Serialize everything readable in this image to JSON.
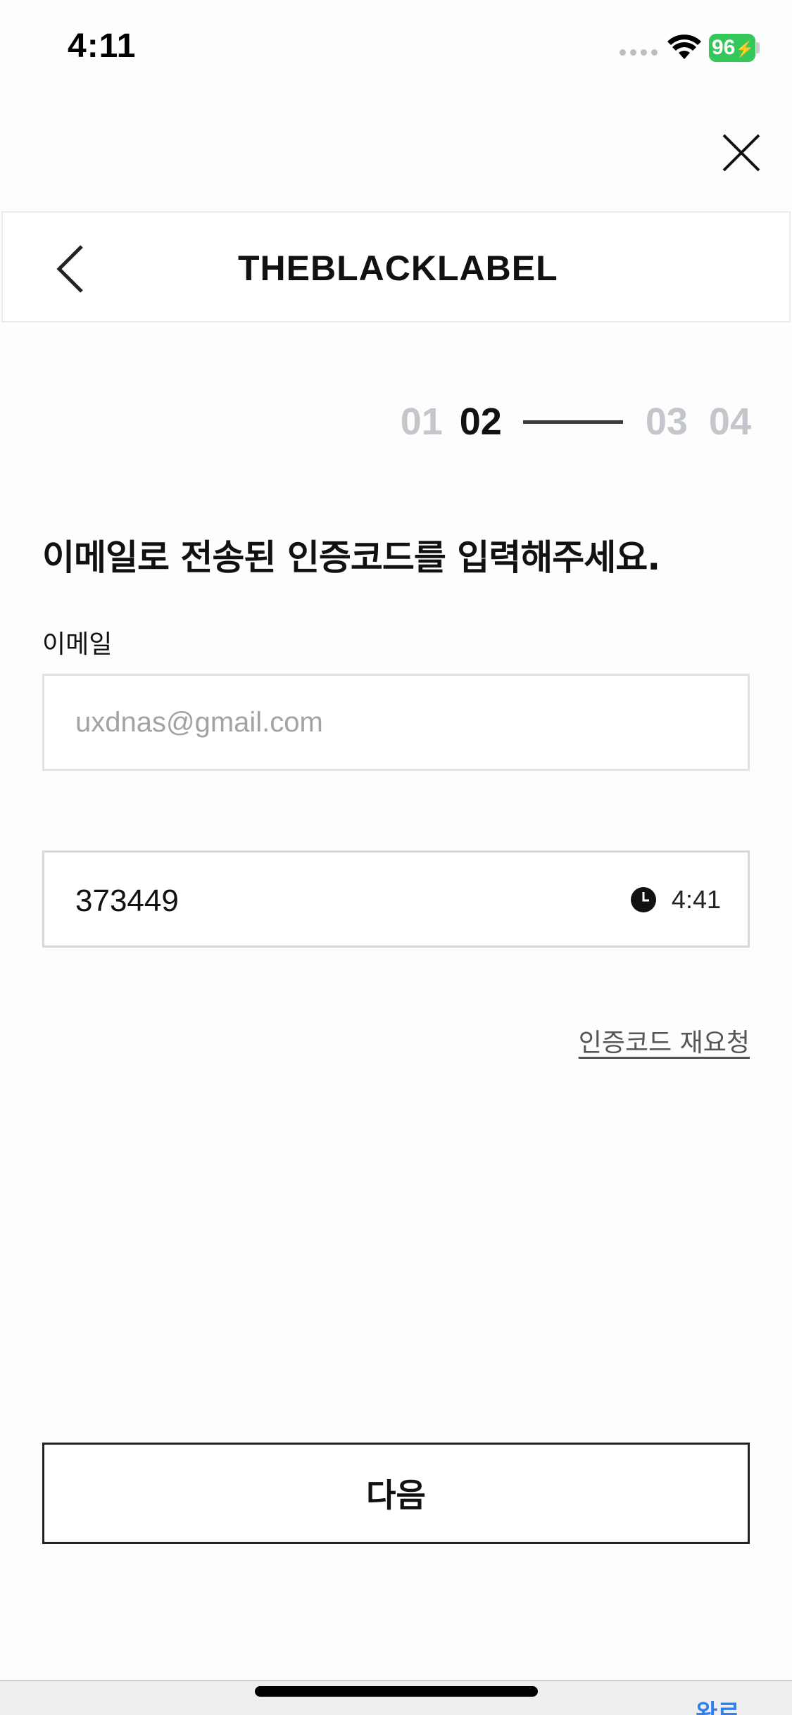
{
  "status_bar": {
    "time": "4:11",
    "battery_level": "96",
    "battery_color": "#34c759"
  },
  "header": {
    "brand": "THEBLACKLABEL",
    "back_icon": "chevron-left-icon",
    "close_icon": "close-icon"
  },
  "steps": {
    "items": [
      "01",
      "02",
      "03",
      "04"
    ],
    "current": "02"
  },
  "content": {
    "headline": "이메일로 전송된 인증코드를 입력해주세요.",
    "email_label": "이메일",
    "email_value": "uxdnas@gmail.com",
    "code_value": "373449",
    "timer": "4:41",
    "timer_icon": "clock-icon",
    "resend_label": "인증코드 재요청"
  },
  "footer": {
    "next_label": "다음",
    "bottom_peek_text": "완료"
  },
  "colors": {
    "accent": "#2f80ed",
    "inactive_step": "#c3c6cb",
    "text": "#111111"
  }
}
